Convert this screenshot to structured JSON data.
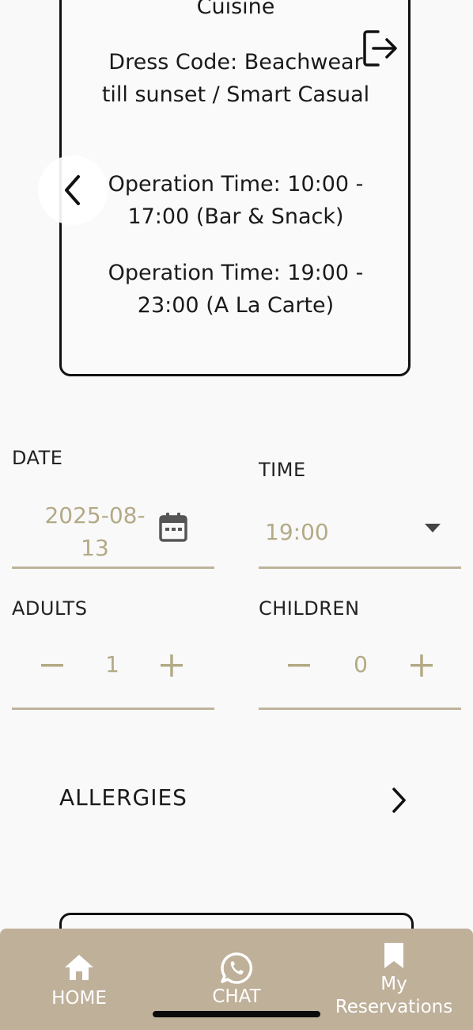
{
  "info_card": {
    "cuisine_tail": "Cuisine",
    "dress_code": "Dress Code: Beachwear till sunset / Smart Casual",
    "operation_time_1": "Operation Time: 10:00 - 17:00 (Bar & Snack)",
    "operation_time_2": "Operation Time: 19:00 - 23:00 (A La Carte)"
  },
  "form": {
    "date_label": "DATE",
    "date_value": "2025-08-13",
    "time_label": "TIME",
    "time_value": "19:00",
    "adults_label": "ADULTS",
    "adults_value": "1",
    "children_label": "CHILDREN",
    "children_value": "0",
    "minus_symbol": "−",
    "plus_symbol": "+"
  },
  "allergies": {
    "label": "ALLERGIES"
  },
  "bottom_nav": {
    "items": [
      {
        "label": "HOME",
        "icon": "home-icon"
      },
      {
        "label": "CHAT",
        "icon": "whatsapp-icon"
      },
      {
        "label": "My Reservations",
        "icon": "bookmark-icon"
      }
    ]
  },
  "colors": {
    "accent": "#bfb09a",
    "value_text": "#b3aa86",
    "underline": "#bfb39b",
    "background": "#f9f9f9"
  }
}
